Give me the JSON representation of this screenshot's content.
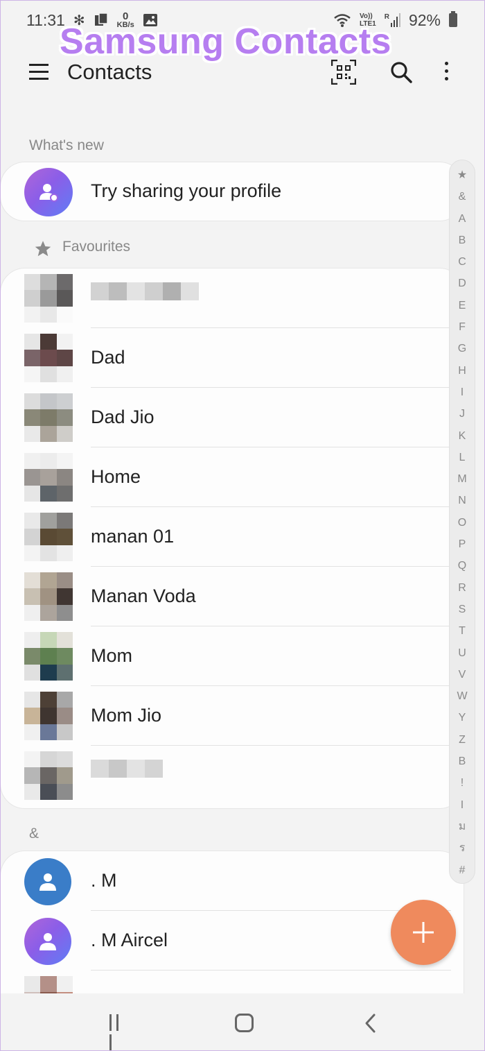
{
  "watermark": "Samsung Contacts",
  "status_bar": {
    "time": "11:31",
    "net_speed_value": "0",
    "net_speed_unit": "KB/s",
    "net_labels": [
      "Vo))",
      "LTE1"
    ],
    "roaming": "R",
    "battery": "92%"
  },
  "app_bar": {
    "title": "Contacts",
    "icons": [
      "menu-icon",
      "qr-code-icon",
      "search-icon",
      "more-vert-icon"
    ]
  },
  "whats_new": {
    "label": "What's new",
    "item": "Try sharing your profile"
  },
  "favourites": {
    "label": "Favourites",
    "contacts": [
      {
        "name": "",
        "blurred": true
      },
      {
        "name": "Dad"
      },
      {
        "name": "Dad Jio"
      },
      {
        "name": "Home"
      },
      {
        "name": "manan 01"
      },
      {
        "name": "Manan Voda"
      },
      {
        "name": "Mom"
      },
      {
        "name": "Mom Jio"
      },
      {
        "name": "",
        "blurred": true
      }
    ]
  },
  "amp_section": {
    "label": "&",
    "contacts": [
      ". M",
      ". M Aircel"
    ]
  },
  "index_letters": [
    "★",
    "&",
    "A",
    "B",
    "C",
    "D",
    "E",
    "F",
    "G",
    "H",
    "I",
    "J",
    "K",
    "L",
    "M",
    "N",
    "O",
    "P",
    "Q",
    "R",
    "S",
    "T",
    "U",
    "V",
    "W",
    "Y",
    "Z",
    "B",
    "!",
    "I",
    "ม",
    "ร",
    "#"
  ],
  "colors": {
    "fab": "#ef8a5d",
    "avatar_blue": "#3a7dc8",
    "avatar_gradient_start": "#b066d8",
    "avatar_gradient_end": "#5f7df5",
    "watermark": "#b67ef0"
  }
}
